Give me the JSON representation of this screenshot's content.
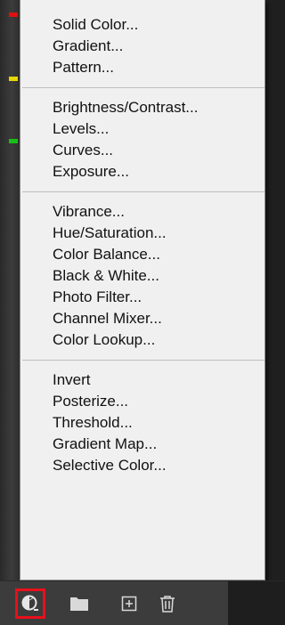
{
  "menu": {
    "groups": [
      {
        "items": [
          "Solid Color...",
          "Gradient...",
          "Pattern..."
        ]
      },
      {
        "items": [
          "Brightness/Contrast...",
          "Levels...",
          "Curves...",
          "Exposure..."
        ]
      },
      {
        "items": [
          "Vibrance...",
          "Hue/Saturation...",
          "Color Balance...",
          "Black & White...",
          "Photo Filter...",
          "Channel Mixer...",
          "Color Lookup..."
        ]
      },
      {
        "items": [
          "Invert",
          "Posterize...",
          "Threshold...",
          "Gradient Map...",
          "Selective Color..."
        ]
      }
    ]
  },
  "toolbar": {
    "buttons": [
      {
        "icon": "adjustment-layer-icon",
        "highlighted": true
      },
      {
        "icon": "folder-icon",
        "highlighted": false
      },
      {
        "icon": "new-layer-icon",
        "highlighted": false
      },
      {
        "icon": "trash-icon",
        "highlighted": false
      }
    ]
  },
  "colors": {
    "menu_bg": "#f0f0f0",
    "highlight": "#e8101a",
    "panel_bg": "#3c3c3c"
  }
}
